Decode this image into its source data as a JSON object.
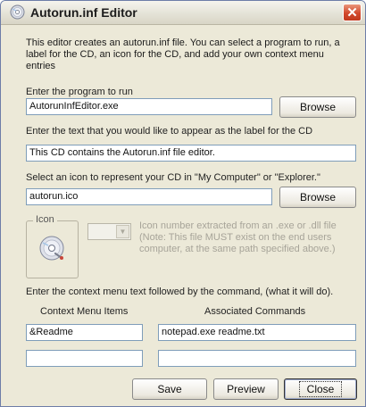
{
  "window": {
    "title": "Autorun.inf Editor",
    "close_glyph": "✕",
    "accent_color": "#d2482c"
  },
  "intro_text": "This editor creates an autorun.inf file.  You can select a program to run, a label for the CD, an icon for the CD,  and add your own context menu entries",
  "program": {
    "label": "Enter the program to run",
    "value": "AutorunInfEditor.exe",
    "browse_label": "Browse"
  },
  "cd_label": {
    "label": "Enter the text that you would like to appear as the label for the CD",
    "value": "This CD contains the Autorun.inf file editor."
  },
  "icon_select": {
    "label": "Select an icon to represent your CD in \"My Computer\" or \"Explorer.\"",
    "value": "autorun.ico",
    "browse_label": "Browse"
  },
  "icon_group": {
    "legend": "Icon",
    "icon": "cd-icon",
    "number_value": "",
    "note": "Icon number extracted from an .exe or .dll file (Note: This file MUST exist on the end users computer, at the same path specified above.)"
  },
  "context_menu": {
    "instruction": "Enter the context menu text followed by the command, (what it will do).",
    "items_header": "Context Menu Items",
    "commands_header": "Associated Commands",
    "rows": [
      {
        "item": "&Readme",
        "command": "notepad.exe readme.txt"
      },
      {
        "item": "",
        "command": ""
      }
    ]
  },
  "buttons": {
    "save": "Save",
    "preview": "Preview",
    "close": "Close"
  }
}
